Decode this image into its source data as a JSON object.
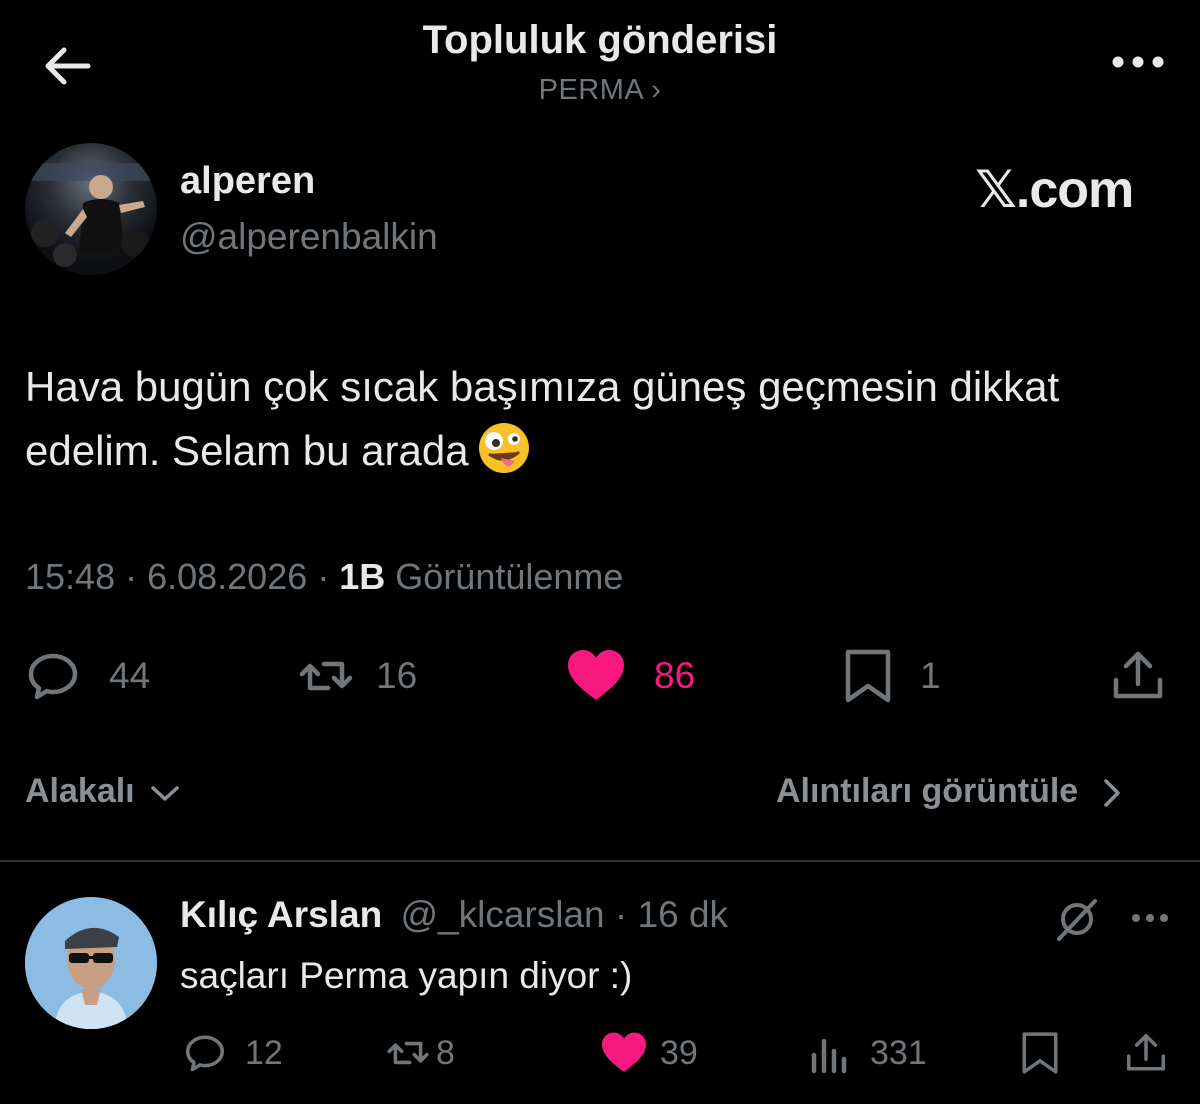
{
  "header": {
    "title": "Topluluk gönderisi",
    "community": "PERMA ›"
  },
  "post": {
    "author_name": "alperen",
    "author_handle": "@alperenbalkin",
    "watermark": "𝕏.com",
    "text": "Hava bugün çok sıcak başımıza güneş geçmesin dikkat edelim. Selam bu arada",
    "emoji": "zany-face",
    "time": "15:48 · 6.08.2026 ·",
    "views_count": "1B",
    "views_label": "Görüntülenme",
    "replies": "44",
    "reposts": "16",
    "likes": "86",
    "bookmarks": "1"
  },
  "sort": {
    "relevance_label": "Alakalı",
    "quotes_label": "Alıntıları görüntüle"
  },
  "reply": {
    "name": "Kılıç Arslan",
    "handle": "@_klcarslan",
    "time": "· 16 dk",
    "text": "saçları Perma yapın diyor :)",
    "replies": "12",
    "reposts": "8",
    "likes": "39",
    "views": "331"
  },
  "colors": {
    "background": "#000000",
    "text": "#e7e9ea",
    "muted": "#71767b",
    "like": "#f91880",
    "divider": "#2f3336"
  }
}
